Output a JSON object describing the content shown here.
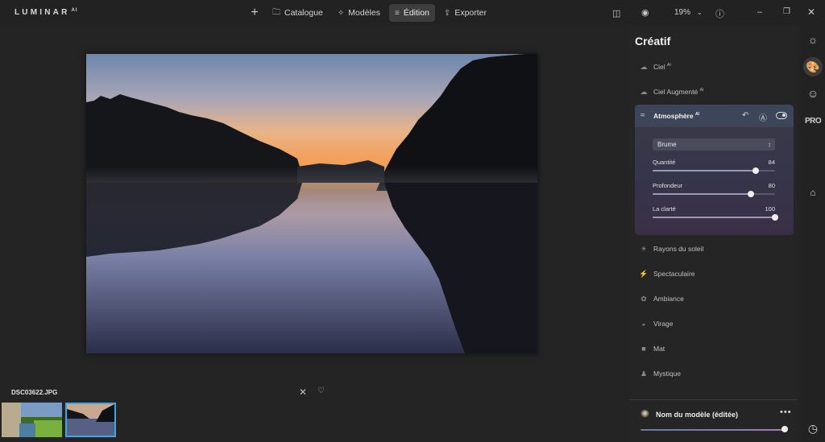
{
  "app": {
    "logo": "LUMINAR",
    "logo_sup": "AI"
  },
  "nav": {
    "add_label": "+",
    "items": [
      {
        "label": "Catalogue",
        "icon": "folder-icon"
      },
      {
        "label": "Modèles",
        "icon": "sparkle-icon"
      },
      {
        "label": "Édition",
        "icon": "sliders-icon",
        "active": true
      },
      {
        "label": "Exporter",
        "icon": "share-icon"
      }
    ]
  },
  "toolbar": {
    "zoom": "19%"
  },
  "photo": {
    "filename": "DSC03622.JPG"
  },
  "panel": {
    "title": "Créatif",
    "tools_top": [
      {
        "label": "Ciel",
        "sup": "AI",
        "icon": "cloud-icon"
      },
      {
        "label": "Ciel Augmenté",
        "sup": "AI",
        "icon": "cloud-plus-icon"
      }
    ],
    "atmosphere": {
      "title": "Atmosphère",
      "sup": "AI",
      "preset": "Brume",
      "sliders": [
        {
          "label": "Quantité",
          "value": "84",
          "fraction": 0.84
        },
        {
          "label": "Profondeur",
          "value": "80",
          "fraction": 0.8
        },
        {
          "label": "La clarté",
          "value": "100",
          "fraction": 1.0
        }
      ]
    },
    "tools_bottom": [
      {
        "label": "Rayons du soleil",
        "icon": "sun-rays-icon"
      },
      {
        "label": "Spectaculaire",
        "icon": "lightning-icon"
      },
      {
        "label": "Ambiance",
        "icon": "ambiance-icon"
      },
      {
        "label": "Virage",
        "icon": "toning-icon"
      },
      {
        "label": "Mat",
        "icon": "matte-icon"
      },
      {
        "label": "Mystique",
        "icon": "mystic-icon"
      }
    ],
    "footer": {
      "preset_name": "Nom du modèle (éditée)",
      "amount_fraction": 0.97
    }
  }
}
